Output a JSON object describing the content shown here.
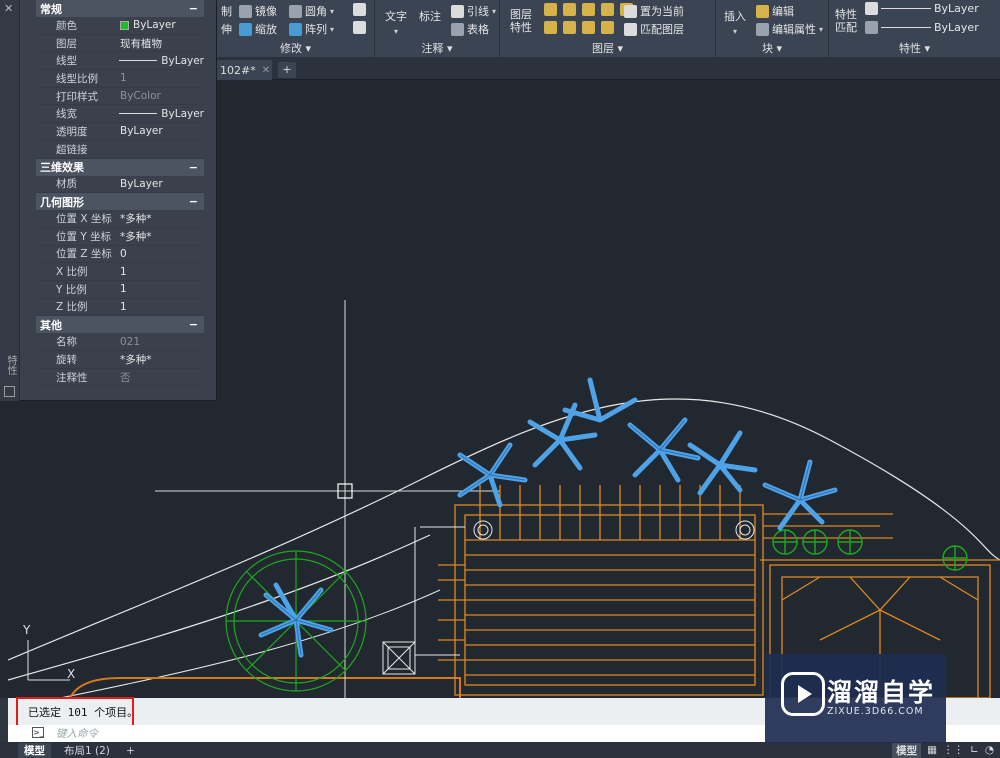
{
  "ribbon": {
    "modify": {
      "title": "修改 ▾",
      "items": [
        "制",
        "镜像",
        "圆角",
        "伸",
        "缩放",
        "阵列"
      ]
    },
    "annotation": {
      "title": "注释 ▾",
      "text": "文字",
      "dim": "标注",
      "leader": "引线",
      "table": "表格"
    },
    "layers": {
      "title": "图层 ▾",
      "props": "图层特性",
      "set_current": "置为当前",
      "match": "匹配图层"
    },
    "block": {
      "title": "块 ▾",
      "insert": "插入",
      "edit": "编辑",
      "edit_attr": "编辑属性"
    },
    "properties": {
      "title": "特性 ▾",
      "match": "特性匹配",
      "line1": "ByLayer",
      "line2": "ByLayer"
    }
  },
  "palette": {
    "side_label": "特性",
    "sections": {
      "general": {
        "title": "常规",
        "collapse": "−"
      },
      "effects3d": {
        "title": "三维效果",
        "collapse": "−"
      },
      "geometry": {
        "title": "几何图形",
        "collapse": "−"
      },
      "misc": {
        "title": "其他",
        "collapse": "−"
      }
    },
    "general_rows": {
      "color": {
        "label": "颜色",
        "value": "ByLayer"
      },
      "layer": {
        "label": "图层",
        "value": "现有植物"
      },
      "linetype": {
        "label": "线型",
        "value": "ByLayer"
      },
      "ltscale": {
        "label": "线型比例",
        "value": "1"
      },
      "plotstyle": {
        "label": "打印样式",
        "value": "ByColor"
      },
      "lineweight": {
        "label": "线宽",
        "value": "ByLayer"
      },
      "transparency": {
        "label": "透明度",
        "value": "ByLayer"
      },
      "hyperlink": {
        "label": "超链接",
        "value": ""
      }
    },
    "effects_rows": {
      "material": {
        "label": "材质",
        "value": "ByLayer"
      }
    },
    "geometry_rows": {
      "posx": {
        "label": "位置 X 坐标",
        "value": "*多种*"
      },
      "posy": {
        "label": "位置 Y 坐标",
        "value": "*多种*"
      },
      "posz": {
        "label": "位置 Z 坐标",
        "value": "0"
      },
      "scalex": {
        "label": "X 比例",
        "value": "1"
      },
      "scaley": {
        "label": "Y 比例",
        "value": "1"
      },
      "scalez": {
        "label": "Z 比例",
        "value": "1"
      }
    },
    "misc_rows": {
      "name": {
        "label": "名称",
        "value": "021"
      },
      "rotation": {
        "label": "旋转",
        "value": "*多种*"
      },
      "annotative": {
        "label": "注释性",
        "value": "否"
      }
    }
  },
  "tabs": {
    "doc": "102#*",
    "close": "✕",
    "new": "+"
  },
  "axes": {
    "y": "Y",
    "x": "X"
  },
  "command": {
    "history": "已选定 101 个项目。",
    "placeholder": "键入命令"
  },
  "status": {
    "model_tab": "模型",
    "layout_tab": "布局1 (2)",
    "add_tab": "+",
    "mode": "模型"
  },
  "watermark": {
    "cn": "溜溜自学",
    "en": "ZIXUE.3D66.COM"
  },
  "colors": {
    "accent_orange": "#e0891f",
    "plant_blue": "#3c8fd6",
    "tree_green": "#1fa81f",
    "bg": "#212830"
  }
}
